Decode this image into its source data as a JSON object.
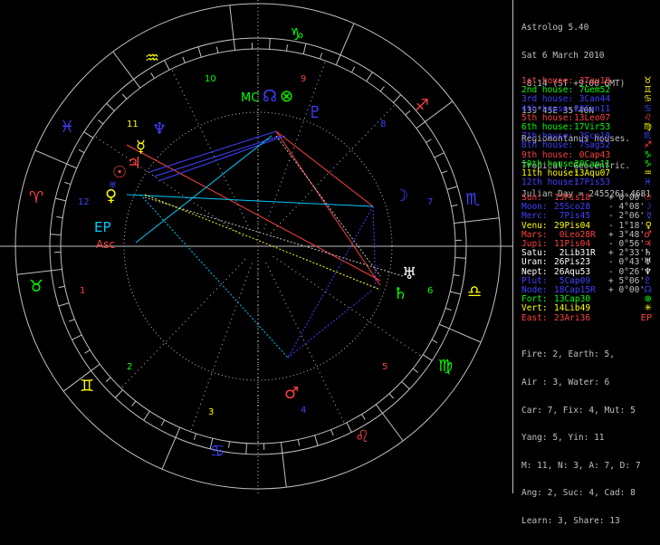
{
  "header": {
    "lines": [
      "Astrolog 5.40",
      "Sat 6 March 2010",
      " 8:14 (ST +9:00 GMT)",
      "139°45E 35°40N",
      "Regiomontanus houses.",
      "Tropical, Geocentric.",
      "Julian Day = 2455261.4681"
    ]
  },
  "houses": [
    {
      "label": "1st house:",
      "value": " 3Tau18",
      "color": "#ff4040",
      "sign_glyph": "♉",
      "sign_color": "#ffff00"
    },
    {
      "label": "2nd house:",
      "value": " 7Gem52",
      "color": "#00ff00",
      "sign_glyph": "♊",
      "sign_color": "#ffff00"
    },
    {
      "label": "3rd house:",
      "value": " 3Can44",
      "color": "#4040ff",
      "sign_glyph": "♋",
      "sign_color": "#ffff00"
    },
    {
      "label": "4th house:",
      "value": "20Can11",
      "color": "#4040ff",
      "sign_glyph": "♋",
      "sign_color": "#4040ff"
    },
    {
      "label": "5th house:",
      "value": "13Leo07",
      "color": "#ff4040",
      "sign_glyph": "♌",
      "sign_color": "#ff4040"
    },
    {
      "label": "6th house:",
      "value": "17Vir53",
      "color": "#00ff00",
      "sign_glyph": "♍",
      "sign_color": "#ffff00"
    },
    {
      "label": "7th house:",
      "value": " 3Sco18",
      "color": "#4040ff",
      "sign_glyph": "♏",
      "sign_color": "#4040ff"
    },
    {
      "label": "8th house:",
      "value": " 7Sag52",
      "color": "#4040ff",
      "sign_glyph": "♐",
      "sign_color": "#ff4040"
    },
    {
      "label": "9th house:",
      "value": " 0Cap43",
      "color": "#ff4040",
      "sign_glyph": "♑",
      "sign_color": "#00ff00"
    },
    {
      "label": "10th house:",
      "value": "20Cap11",
      "color": "#00ff00",
      "sign_glyph": "♑",
      "sign_color": "#00ff00"
    },
    {
      "label": "11th house:",
      "value": "13Aqu07",
      "color": "#ffff00",
      "sign_glyph": "♒",
      "sign_color": "#ffff00"
    },
    {
      "label": "12th house:",
      "value": "17Pis53",
      "color": "#4040ff",
      "sign_glyph": "♓",
      "sign_color": "#4040ff"
    }
  ],
  "planets": [
    {
      "name": "Sun:",
      "pos": "15Pis18",
      "motion": "+ 0°00'",
      "color": "#ff4040",
      "glyph": "☉"
    },
    {
      "name": "Moon:",
      "pos": "25Sco28",
      "motion": "- 4°08'",
      "color": "#4040ff",
      "glyph": "☽"
    },
    {
      "name": "Merc:",
      "pos": " 7Pis45",
      "motion": "- 2°06'",
      "color": "#4040ff",
      "glyph": "☿"
    },
    {
      "name": "Venu:",
      "pos": "29Pis04",
      "motion": "- 1°18'",
      "color": "#ffff00",
      "glyph": "♀"
    },
    {
      "name": "Mars:",
      "pos": " 0Leo28R",
      "motion": "+ 3°48'",
      "color": "#ff4040",
      "glyph": "♂"
    },
    {
      "name": "Jupi:",
      "pos": "11Pis04",
      "motion": "- 0°56'",
      "color": "#ff4040",
      "glyph": "♃"
    },
    {
      "name": "Satu:",
      "pos": " 2Lib31R",
      "motion": "+ 2°33'",
      "color": "#ffffff",
      "glyph": "♄"
    },
    {
      "name": "Uran:",
      "pos": "26Pis23",
      "motion": "- 0°43'",
      "color": "#ffffff",
      "glyph": "♅"
    },
    {
      "name": "Nept:",
      "pos": "26Aqu53",
      "motion": "- 0°26'",
      "color": "#ffffff",
      "glyph": "♆"
    },
    {
      "name": "Plut:",
      "pos": " 5Cap09",
      "motion": "+ 5°06'",
      "color": "#4040ff",
      "glyph": "♇"
    },
    {
      "name": "Node:",
      "pos": "18Cap15R",
      "motion": "+ 0°00'",
      "color": "#4040ff",
      "glyph": "☊"
    },
    {
      "name": "Fort:",
      "pos": "13Cap30",
      "motion": "",
      "color": "#00ff00",
      "glyph": "⊗"
    },
    {
      "name": "Vert:",
      "pos": "14Lib49",
      "motion": "",
      "color": "#ffff00",
      "glyph": "✳"
    },
    {
      "name": "East:",
      "pos": "23Ari36",
      "motion": "",
      "color": "#ff4040",
      "glyph": "EP"
    }
  ],
  "stats": [
    "Fire: 2, Earth: 5,",
    "Air : 3, Water: 6",
    "Car: 7, Fix: 4, Mut: 5",
    "Yang: 5, Yin: 11",
    "M: 11, N: 3, A: 7, D: 7",
    "Ang: 2, Suc: 4, Cad: 8",
    "Learn: 3, Share: 13"
  ],
  "wheel": {
    "house_numbers": [
      "1",
      "2",
      "3",
      "4",
      "5",
      "6",
      "7",
      "8",
      "9",
      "10",
      "11",
      "12"
    ],
    "axis_labels": {
      "asc": "Asc",
      "mc": "MC",
      "ep": "EP"
    },
    "colors": {
      "red": "#ff4040",
      "green": "#00ff00",
      "blue": "#4040ff",
      "yellow": "#ffff00",
      "cyan": "#00c8ff",
      "white": "#ffffff",
      "grey": "#c0c0c0"
    }
  }
}
